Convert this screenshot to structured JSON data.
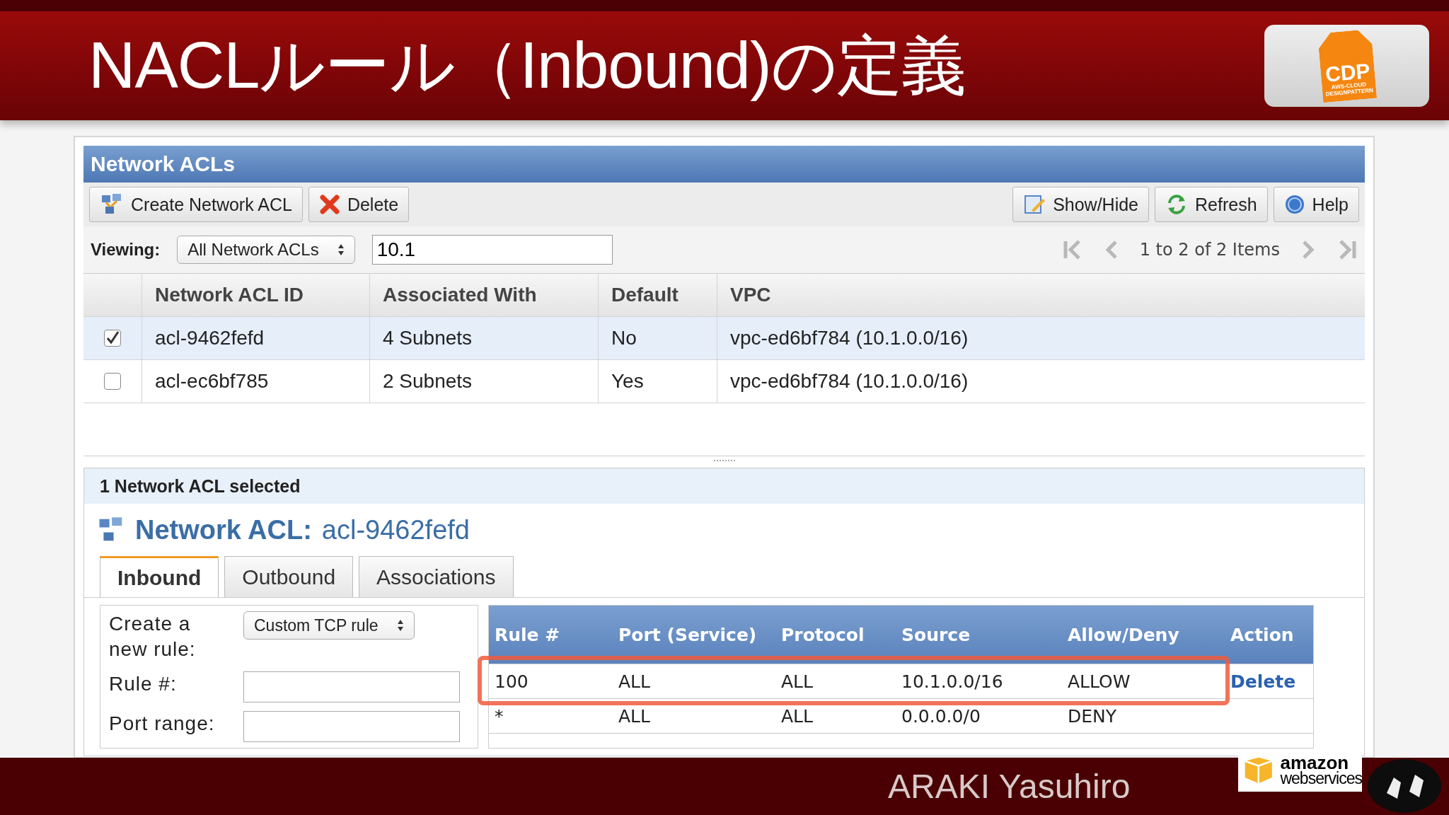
{
  "slide": {
    "title": "NACLルール（Inbound)の定義",
    "logo": {
      "name": "CDP",
      "tagline": [
        "AWS-CLOUD",
        "DESIGNPATTERN"
      ]
    },
    "author": "ARAKI Yasuhiro",
    "partner_logo": [
      "amazon",
      "webservices"
    ]
  },
  "panel": {
    "title": "Network ACLs",
    "toolbar_left": [
      {
        "label": "Create Network ACL",
        "kind": "network"
      },
      {
        "label": "Delete",
        "kind": "delete"
      }
    ],
    "toolbar_right": [
      {
        "label": "Show/Hide",
        "kind": "showhide"
      },
      {
        "label": "Refresh",
        "kind": "refresh"
      },
      {
        "label": "Help",
        "kind": "help"
      }
    ],
    "viewing_label": "Viewing:",
    "viewing_select": "All Network ACLs",
    "filter_value": "10.1",
    "pager": "1 to 2 of 2 Items"
  },
  "table": {
    "columns": [
      "Network ACL ID",
      "Associated With",
      "Default",
      "VPC"
    ],
    "rows": [
      {
        "selected": true,
        "cells": [
          "acl-9462fefd",
          "4 Subnets",
          "No",
          "vpc-ed6bf784 (10.1.0.0/16)"
        ]
      },
      {
        "selected": false,
        "cells": [
          "acl-ec6bf785",
          "2 Subnets",
          "Yes",
          "vpc-ed6bf784 (10.1.0.0/16)"
        ]
      }
    ]
  },
  "details": {
    "summary": "1 Network ACL selected",
    "heading_label": "Network ACL:",
    "heading_value": "acl-9462fefd",
    "tabs": [
      {
        "label": "Inbound",
        "selected": true
      },
      {
        "label": "Outbound",
        "selected": false
      },
      {
        "label": "Associations",
        "selected": false
      }
    ],
    "form": {
      "create_label": "Create a new rule:",
      "rule_type": "Custom TCP rule",
      "fields": [
        {
          "label": "Rule #:"
        },
        {
          "label": "Port range:"
        }
      ]
    },
    "rules": {
      "columns": [
        "Rule #",
        "Port (Service)",
        "Protocol",
        "Source",
        "Allow/Deny",
        "Action"
      ],
      "rows": [
        {
          "cells": [
            "100",
            "ALL",
            "ALL",
            "10.1.0.0/16",
            "ALLOW"
          ],
          "action": "Delete",
          "highlighted": true
        },
        {
          "cells": [
            "*",
            "ALL",
            "ALL",
            "0.0.0.0/0",
            "DENY"
          ],
          "highlighted": false
        }
      ]
    }
  }
}
